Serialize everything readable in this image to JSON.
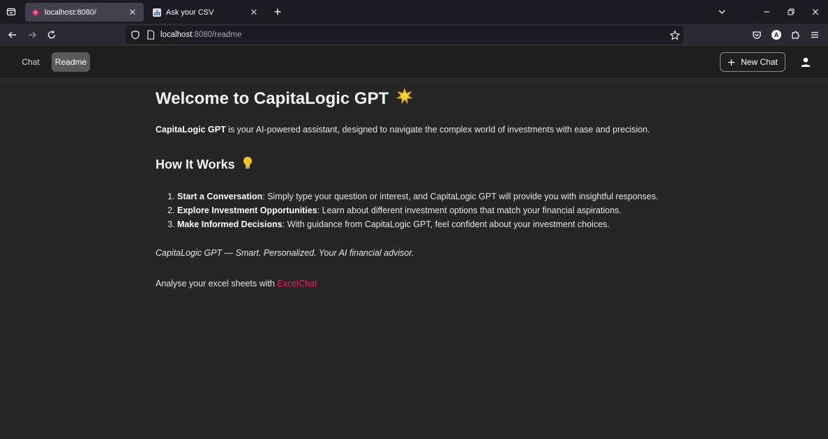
{
  "browser": {
    "tabs": [
      {
        "title": "localhost:8080/",
        "active": true
      },
      {
        "title": "Ask your CSV",
        "active": false
      }
    ],
    "new_tab": "+",
    "url": {
      "host": "localhost",
      "path": ":8080/readme"
    },
    "profile_initial": "A"
  },
  "app": {
    "nav": {
      "chat_label": "Chat",
      "readme_label": "Readme"
    },
    "new_chat_label": "New Chat",
    "accent_color": "#e0245e"
  },
  "readme": {
    "title": "Welcome to CapitaLogic GPT",
    "title_emoji": "🌟",
    "intro_bold": "CapitaLogic GPT",
    "intro_rest": " is your AI-powered assistant, designed to navigate the complex world of investments with ease and precision.",
    "how_title": "How It Works",
    "how_emoji": "💡",
    "steps": [
      {
        "bold": "Start a Conversation",
        "text": ": Simply type your question or interest, and CapitaLogic GPT will provide you with insightful responses."
      },
      {
        "bold": "Explore Investment Opportunities",
        "text": ": Learn about different investment options that match your financial aspirations."
      },
      {
        "bold": "Make Informed Decisions",
        "text": ": With guidance from CapitaLogic GPT, feel confident about your investment choices."
      }
    ],
    "tagline": "CapitaLogic GPT — Smart. Personalized. Your AI financial advisor.",
    "excel_prefix": "Analyse your excel sheets with ",
    "excel_link": "ExcelChat"
  }
}
